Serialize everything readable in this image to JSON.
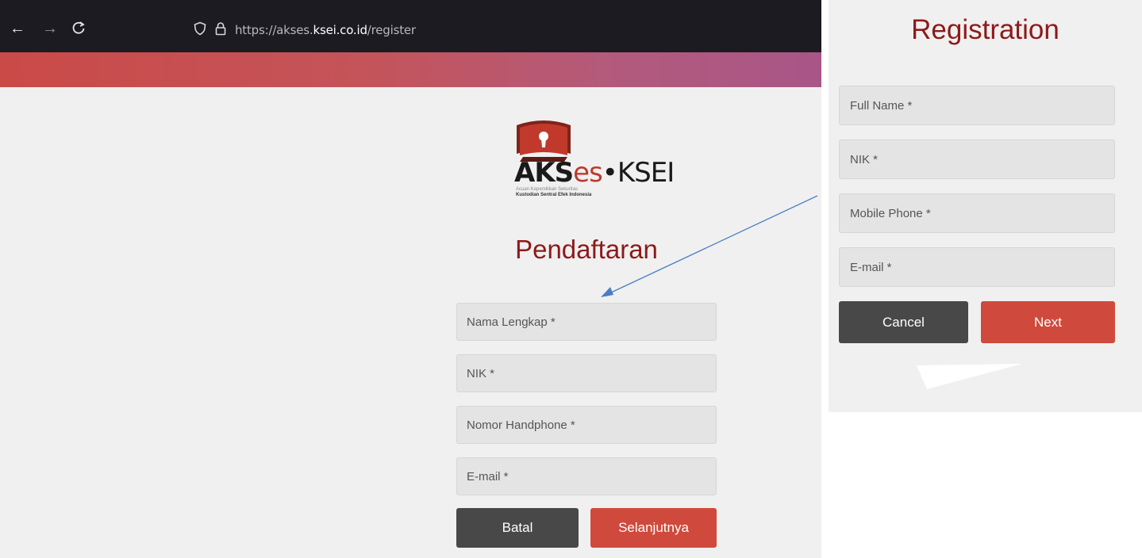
{
  "browser": {
    "url_prefix": "https://akses.",
    "url_domain": "ksei.co.id",
    "url_path": "/register"
  },
  "logo": {
    "brand_bold": "AKS",
    "brand_es": "es",
    "brand_sep": "•",
    "brand_ksei": "KSEI",
    "tagline1": "Acuan Kepemilikan Sekuritas",
    "tagline2": "Kustodian Sentral Efek Indonesia"
  },
  "form_id": {
    "title": "Pendaftaran",
    "fields": [
      "Nama Lengkap *",
      "NIK *",
      "Nomor Handphone *",
      "E-mail *"
    ],
    "cancel_label": "Batal",
    "next_label": "Selanjutnya"
  },
  "form_en": {
    "title": "Registration",
    "fields": [
      "Full Name *",
      "NIK *",
      "Mobile Phone *",
      "E-mail *"
    ],
    "cancel_label": "Cancel",
    "next_label": "Next"
  },
  "colors": {
    "brand_red": "#cf4a3c",
    "title_red": "#8d1a1a",
    "dark_button": "#484848",
    "arrow": "#4a7ec2"
  }
}
